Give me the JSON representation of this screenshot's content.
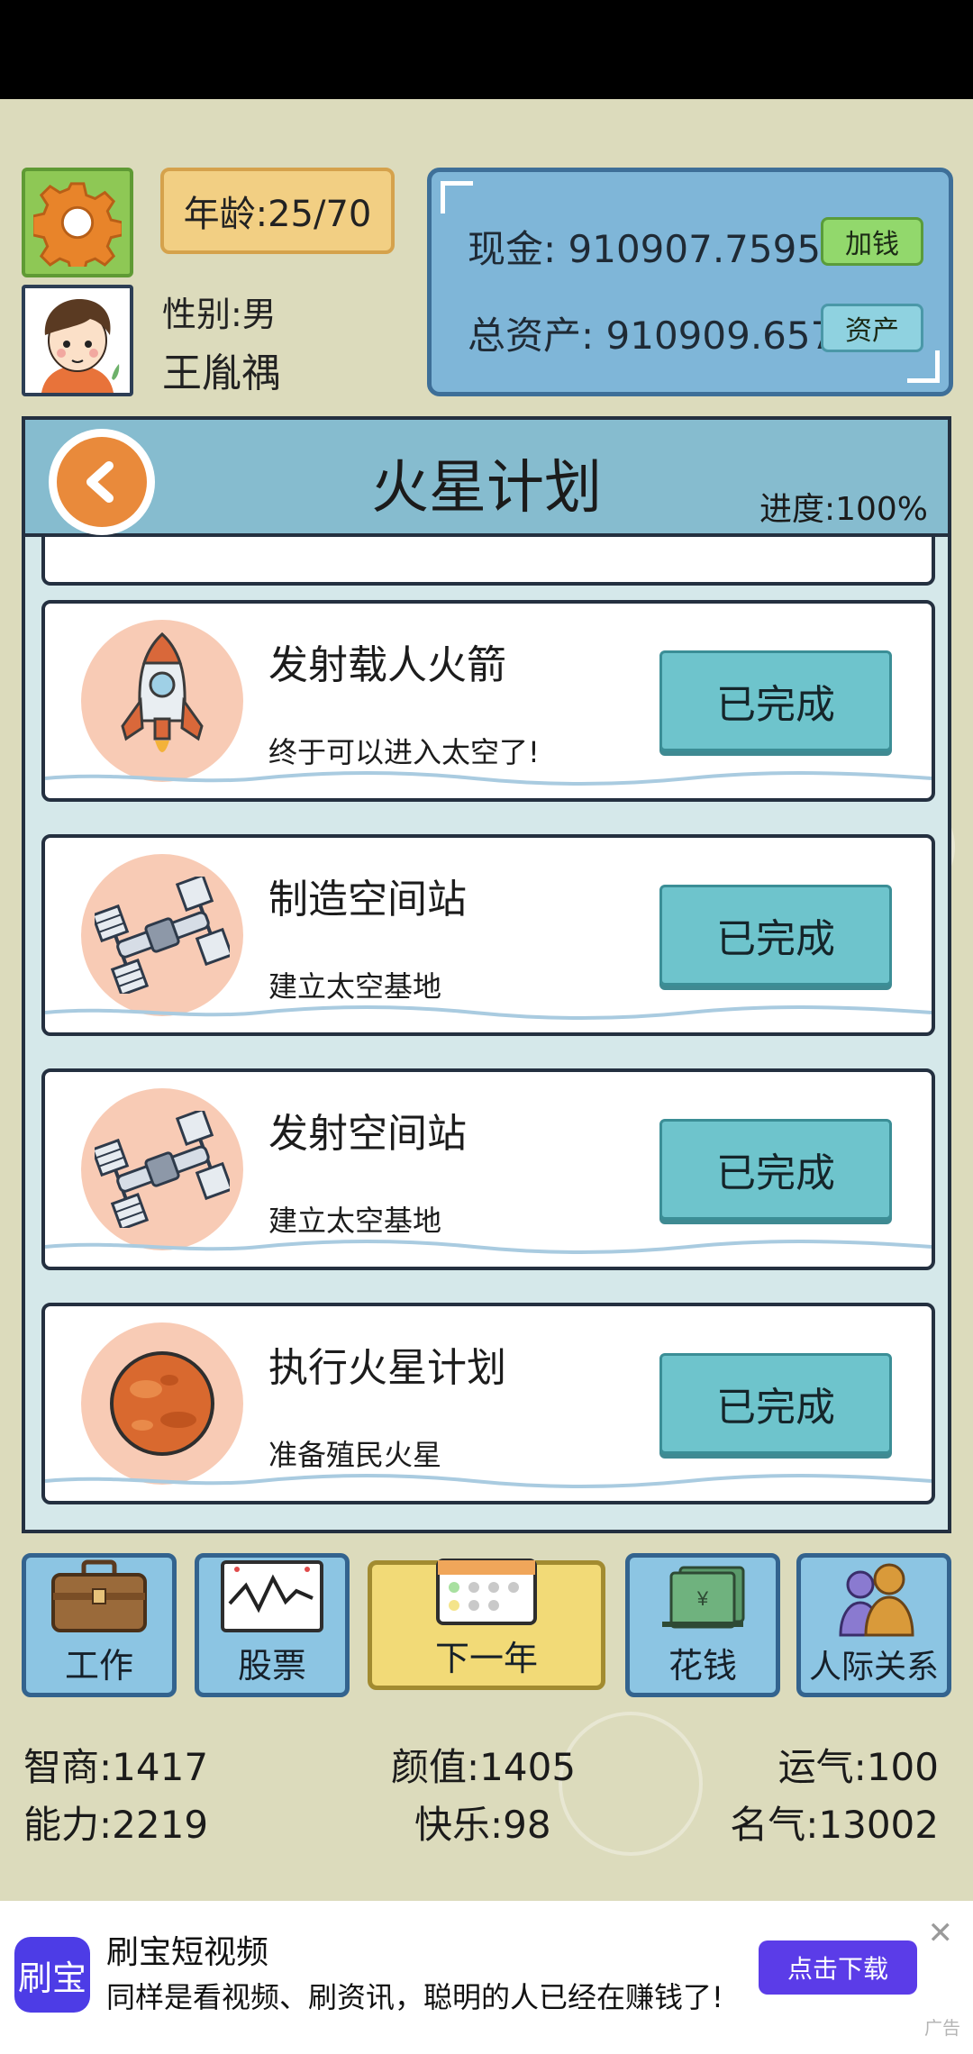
{
  "top": {
    "age": "年龄:25/70",
    "gender": "性别:男",
    "name": "王胤禑",
    "cash": "现金: 910907.7595亿",
    "assets": "总资产: 910909.657亿",
    "add_money_label": "加钱",
    "assets_button_label": "资产"
  },
  "panel": {
    "title": "火星计划",
    "progress": "进度:100%",
    "tasks": [
      {
        "name": "发射载人火箭",
        "desc": "终于可以进入太空了!",
        "status": "已完成",
        "icon": "rocket-icon"
      },
      {
        "name": "制造空间站",
        "desc": "建立太空基地",
        "status": "已完成",
        "icon": "space-station-icon"
      },
      {
        "name": "发射空间站",
        "desc": "建立太空基地",
        "status": "已完成",
        "icon": "space-station-icon"
      },
      {
        "name": "执行火星计划",
        "desc": "准备殖民火星",
        "status": "已完成",
        "icon": "mars-icon"
      }
    ]
  },
  "nav": {
    "work": "工作",
    "stocks": "股票",
    "next_year": "下一年",
    "spend": "花钱",
    "relations": "人际关系"
  },
  "stats": {
    "iq": "智商:1417",
    "looks": "颜值:1405",
    "luck": "运气:100",
    "ability": "能力:2219",
    "happiness": "快乐:98",
    "fame": "名气:13002"
  },
  "ad": {
    "logo_text": "刷宝",
    "title": "刷宝短视频",
    "desc": "同样是看视频、刷资讯，聪明的人已经在赚钱了!",
    "button": "点击下载",
    "close": "✕",
    "tag": "广告"
  },
  "colors": {
    "background": "#dcdbbc",
    "panel_header": "#86bccf",
    "done_button": "#6ec4cc",
    "money_panel": "#7fb6d8"
  }
}
